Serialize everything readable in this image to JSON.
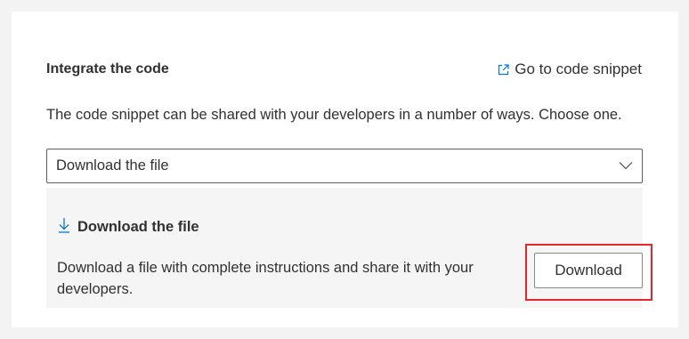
{
  "section": {
    "title": "Integrate the code",
    "link_label": "Go to code snippet",
    "link_icon": "open-in-new-window-icon",
    "description": "The code snippet can be shared with your developers in a number of ways. Choose one."
  },
  "method_select": {
    "value": "Download the file",
    "icon": "chevron-down-icon"
  },
  "download_panel": {
    "icon": "download-arrow-icon",
    "title": "Download the file",
    "description": " Download a file with complete instructions and share it with your developers.",
    "button_label": "Download",
    "highlight_color": "#e3262e"
  },
  "colors": {
    "accent": "#0078d4",
    "page_background": "#f3f3f3",
    "panel_background": "#f5f5f5"
  }
}
